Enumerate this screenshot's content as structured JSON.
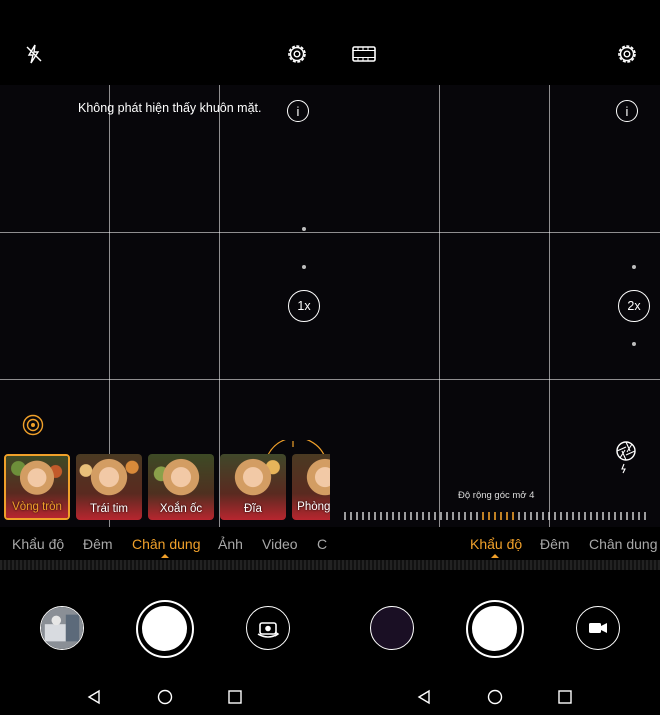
{
  "left": {
    "top_icons": [
      "flash-off-icon",
      "settings-gear-icon"
    ],
    "notice": "Không phát hiện thấy khuôn mặt.",
    "info_icon": "info-icon",
    "zoom_label": "1x",
    "effect_icon": "bokeh-effect-icon",
    "effects": [
      {
        "label": "Vòng tròn",
        "selected": true
      },
      {
        "label": "Trái tim",
        "selected": false
      },
      {
        "label": "Xoắn ốc",
        "selected": false
      },
      {
        "label": "Đĩa",
        "selected": false
      },
      {
        "label": "Phòng ánh",
        "selected": false
      }
    ],
    "modes": [
      "Khẩu độ",
      "Đêm",
      "Chân dung",
      "Ảnh",
      "Video",
      "C"
    ],
    "active_mode": "Chân dung"
  },
  "right": {
    "top_icons": [
      "filmstrip-icon",
      "settings-gear-icon"
    ],
    "info_icon": "info-icon",
    "zoom_label": "2x",
    "aperture_icon": "aperture-icon",
    "aperture_label": "Độ rộng góc mở 4",
    "modes": [
      "Khẩu độ",
      "Đêm",
      "Chân dung"
    ],
    "active_mode": "Khẩu độ"
  },
  "nav_icons": [
    "back-triangle-icon",
    "home-circle-icon",
    "recents-square-icon"
  ],
  "colors": {
    "accent": "#f0a02a",
    "background": "#000000",
    "viewfinder": "#07060a"
  }
}
